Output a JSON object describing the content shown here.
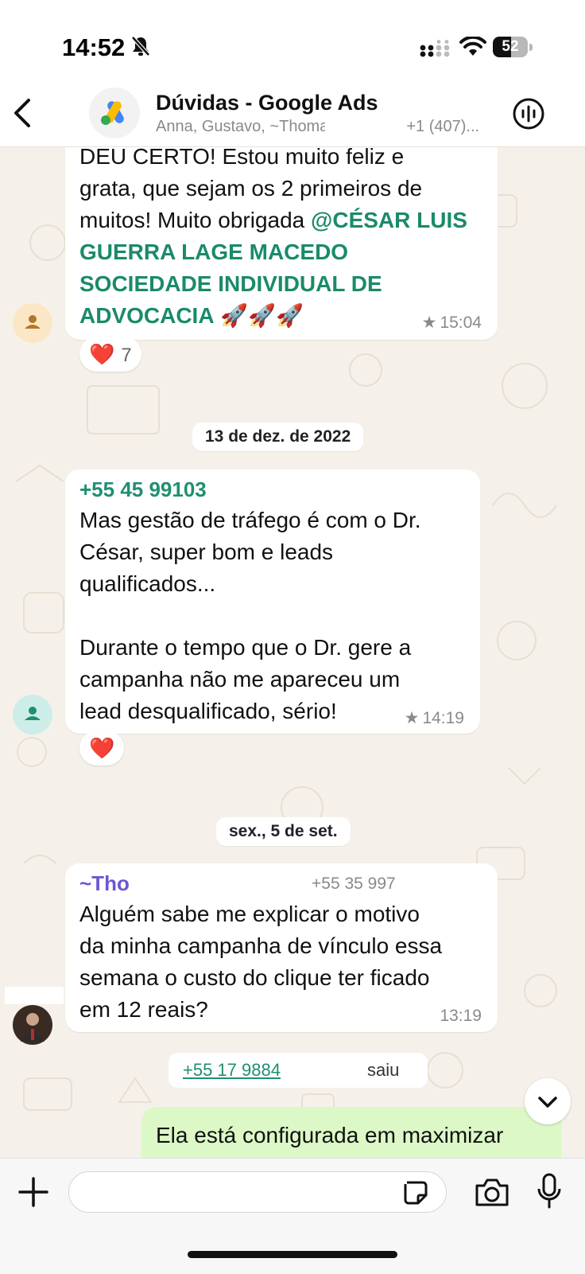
{
  "status": {
    "time": "14:52",
    "battery": "52",
    "battery_level": 0.52
  },
  "header": {
    "title": "Dúvidas - Google Ads",
    "subtitle_a": "Anna, Gustavo, ~Thoma",
    "subtitle_b": "+1 (407)..."
  },
  "messages": [
    {
      "text_a": "DEU CERTO! Estou muito feliz e\ngrata, que sejam os 2 primeiros de\nmuitos! Muito obrigada ",
      "mention": "@CÉSAR LUIS GUERRA LAGE MACEDO SOCIEDADE INDIVIDUAL DE ADVOCACIA",
      "emoji": "🚀🚀🚀",
      "time": "15:04",
      "reaction": "❤️",
      "reaction_count": "7"
    },
    {
      "date": "13 de dez. de 2022",
      "sender": "+55 45 99103",
      "text": "Mas gestão de tráfego é com o Dr.\nCésar, super bom e leads\nqualificados...\n\nDurante o tempo que o Dr. gere a\ncampanha não me apareceu um\nlead desqualificado, sério!",
      "time": "14:19",
      "reaction": "❤️"
    },
    {
      "date": "sex., 5 de set.",
      "sender": "~Tho",
      "phone": "+55 35 997",
      "text": "Alguém sabe me explicar o motivo\nda minha campanha de vínculo essa\nsemana o custo do clique ter ficado\nem 12 reais?",
      "time": "13:19"
    }
  ],
  "system": {
    "phone": "+55 17 9884",
    "action": "saiu"
  },
  "outgoing_preview": "Ela está configurada em maximizar",
  "composer": {
    "placeholder": ""
  },
  "colors": {
    "mention": "#1a8a6b",
    "sender_green": "#1f8f72",
    "sender_purple": "#6a57d5",
    "outgoing": "#dcf8c6"
  }
}
